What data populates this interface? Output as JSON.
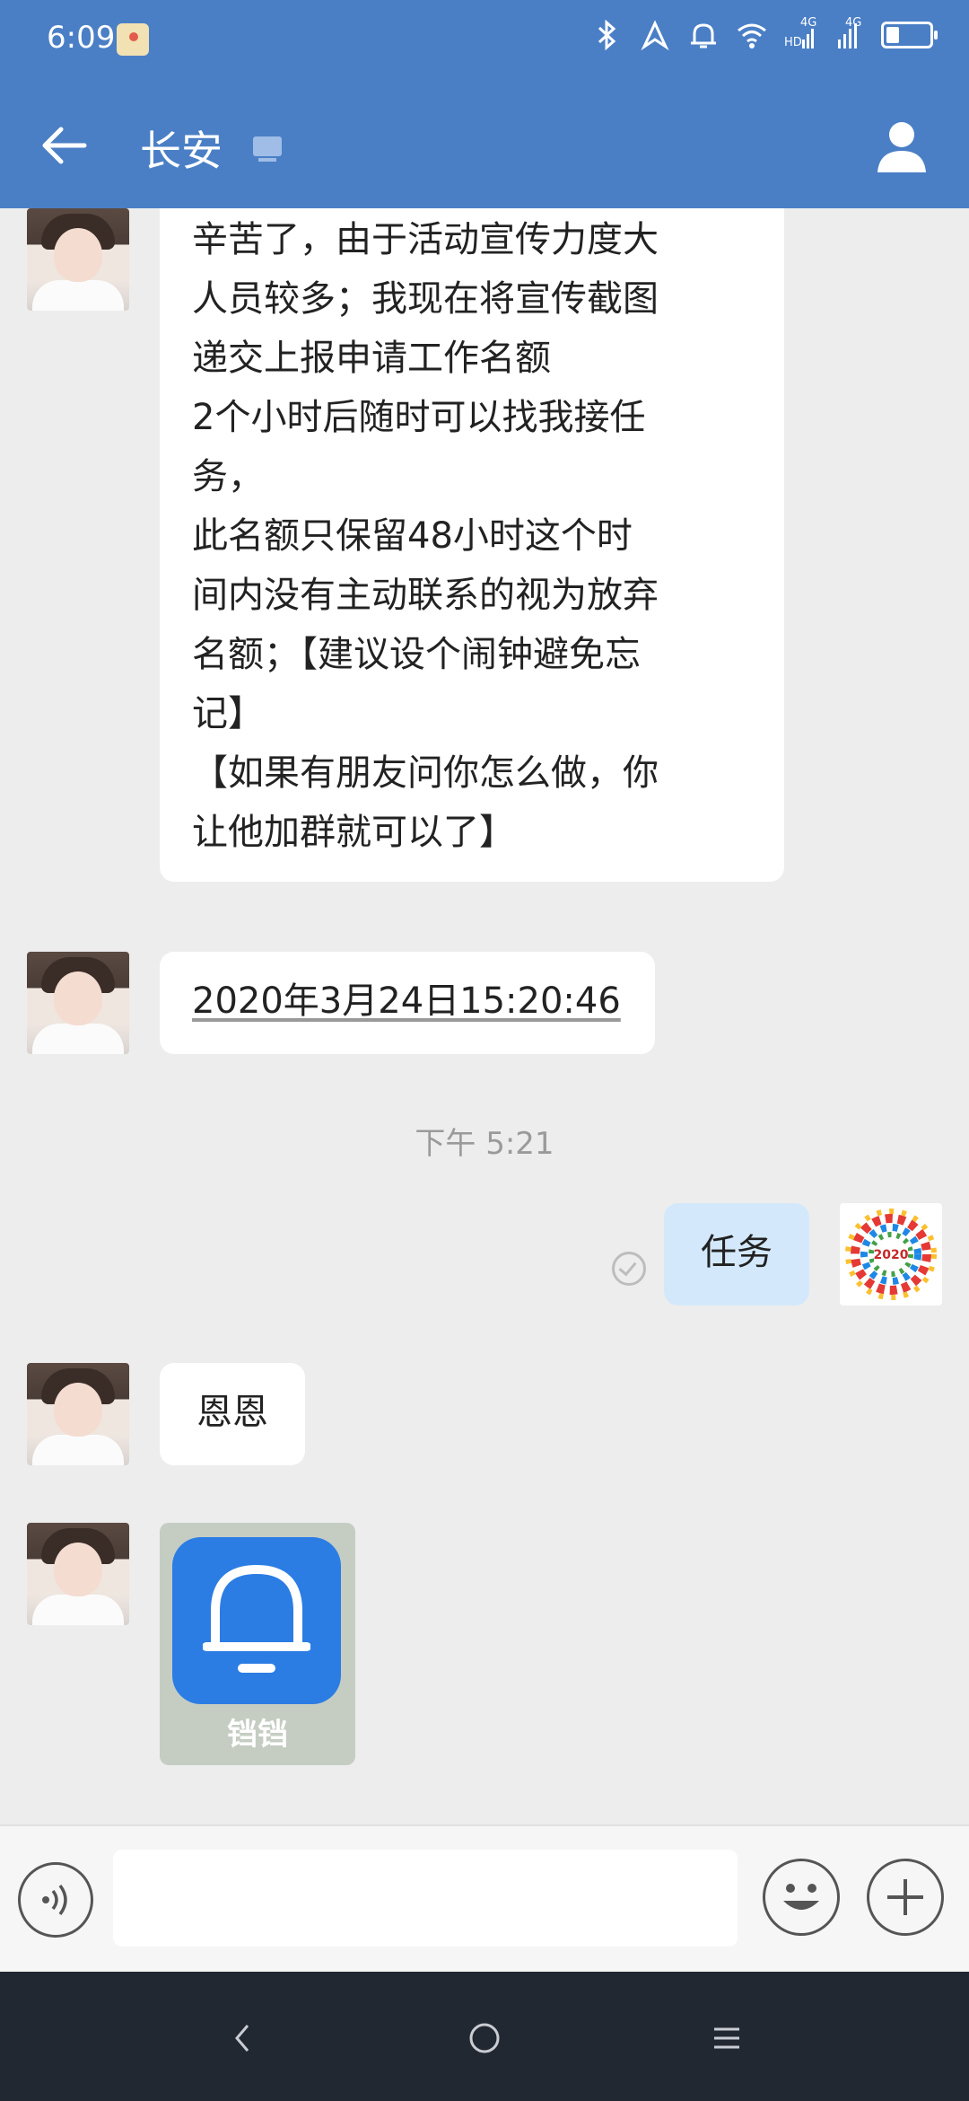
{
  "status_bar": {
    "time": "6:09",
    "signal_labels": [
      "HD",
      "4G",
      "4G"
    ],
    "icons": [
      "notification-app-icon",
      "bluetooth-icon",
      "location-icon",
      "alarm-icon",
      "wifi-icon",
      "signal-icon",
      "signal-icon",
      "battery-icon"
    ]
  },
  "header": {
    "title": "长安",
    "back_icon": "arrow-left-icon",
    "device_icon": "computer-icon",
    "profile_icon": "user-profile-icon",
    "background": "#4a7fc6"
  },
  "messages": [
    {
      "side": "left",
      "lines": [
        "辛苦了，由于活动宣传力度大",
        "人员较多；我现在将宣传截图",
        "递交上报申请工作名额",
        "2个小时后随时可以找我接任",
        "务，",
        "此名额只保留48小时这个时",
        "间内没有主动联系的视为放弃",
        "名额；【建议设个闹钟避免忘",
        "记】",
        "【如果有朋友问你怎么做，你",
        "让他加群就可以了】"
      ]
    },
    {
      "side": "left",
      "text": "2020年3月24日15:20:46"
    },
    {
      "type": "timestamp",
      "text": "下午 5:21"
    },
    {
      "side": "right",
      "text": "任务",
      "avatar_text": "2020"
    },
    {
      "side": "left",
      "text": "恩恩"
    },
    {
      "side": "left",
      "type": "app-card",
      "app_name": "铛铛",
      "app_icon": "bell-icon"
    }
  ],
  "input_bar": {
    "voice_icon": "voice-icon",
    "emoji_icon": "emoji-icon",
    "plus_icon": "plus-icon"
  },
  "nav_bar": {
    "icons": [
      "back-nav-icon",
      "home-nav-icon",
      "menu-nav-icon"
    ]
  }
}
